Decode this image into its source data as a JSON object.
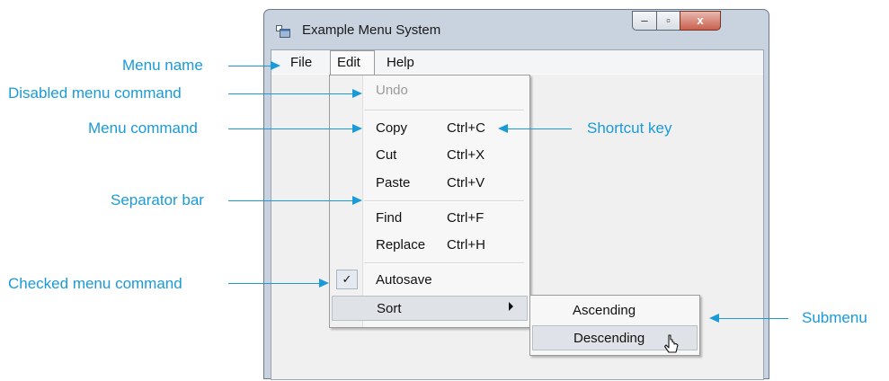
{
  "window": {
    "title": "Example Menu System",
    "controls": {
      "minimize": "–",
      "maximize": "▫",
      "close": "x"
    }
  },
  "menubar": {
    "items": [
      "File",
      "Edit",
      "Help"
    ]
  },
  "edit_menu": {
    "items": [
      {
        "label": "Undo",
        "shortcut": "",
        "disabled": true
      },
      {
        "label": "Copy",
        "shortcut": "Ctrl+C"
      },
      {
        "label": "Cut",
        "shortcut": "Ctrl+X"
      },
      {
        "label": "Paste",
        "shortcut": "Ctrl+V"
      },
      {
        "label": "Find",
        "shortcut": "Ctrl+F"
      },
      {
        "label": "Replace",
        "shortcut": "Ctrl+H"
      },
      {
        "label": "Autosave",
        "shortcut": "",
        "checked": true,
        "check_glyph": "✓"
      },
      {
        "label": "Sort",
        "shortcut": "",
        "has_submenu": true
      }
    ]
  },
  "submenu": {
    "items": [
      "Ascending",
      "Descending"
    ],
    "highlighted": "Descending"
  },
  "annotations": {
    "menu_name": "Menu name",
    "disabled_cmd": "Disabled menu command",
    "menu_cmd": "Menu command",
    "separator": "Separator bar",
    "checked_cmd": "Checked menu command",
    "shortcut_key": "Shortcut key",
    "submenu": "Submenu"
  },
  "colors": {
    "annotation": "#1a9ad6",
    "highlight": "#dfe2e6"
  }
}
